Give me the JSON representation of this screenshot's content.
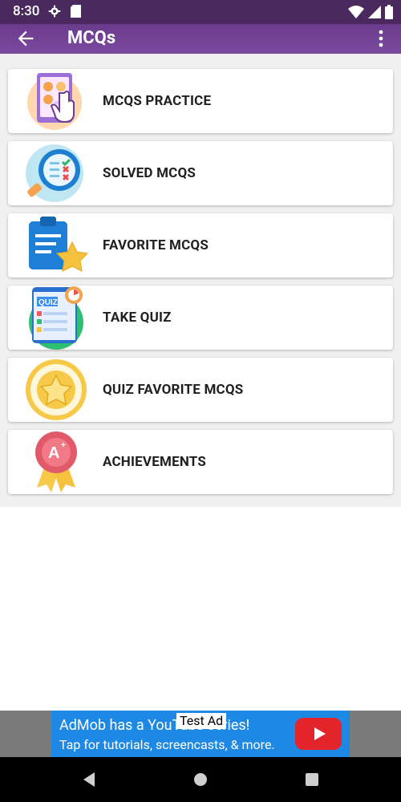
{
  "status_bar": {
    "time": "8:30",
    "icons": [
      "gear-icon",
      "sd-card-icon",
      "wifi-icon",
      "signal-icon",
      "battery-icon"
    ]
  },
  "app_bar": {
    "title": "MCQs",
    "back_icon": "arrow-back-icon",
    "menu_icon": "more-vert-icon"
  },
  "menu": {
    "items": [
      {
        "label": "MCQS PRACTICE",
        "icon": "practice-tablet-icon"
      },
      {
        "label": "SOLVED MCQS",
        "icon": "magnifier-check-icon"
      },
      {
        "label": "FAVORITE MCQS",
        "icon": "clipboard-star-icon"
      },
      {
        "label": "TAKE QUIZ",
        "icon": "quiz-board-icon"
      },
      {
        "label": "QUIZ FAVORITE MCQS",
        "icon": "star-circle-icon"
      },
      {
        "label": "ACHIEVEMENTS",
        "icon": "badge-ribbon-icon"
      }
    ]
  },
  "ad": {
    "badge": "Test Ad",
    "line1": "AdMob has a YouTube series!",
    "line2": "Tap for tutorials, screencasts, & more."
  },
  "colors": {
    "status_bar": "#4a2a5e",
    "app_bar": "#7a4aa0",
    "ad_blue": "#1e88e5"
  }
}
